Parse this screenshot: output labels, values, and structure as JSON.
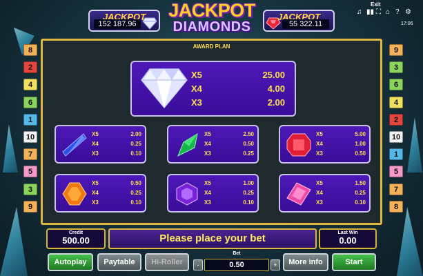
{
  "header": {
    "jackpot_left": {
      "title": "JACKPOT",
      "value": "152 187.96"
    },
    "jackpot_right": {
      "title": "JACKPOT",
      "value": "55 322.11"
    },
    "logo_line1": "JACKPOT",
    "logo_line2": "DIAMONDS",
    "exit_label": "Exit",
    "clock": "17:06"
  },
  "lines_left": [
    {
      "number": "8",
      "color": "#f3b15a"
    },
    {
      "number": "2",
      "color": "#e2463e"
    },
    {
      "number": "4",
      "color": "#f0e060"
    },
    {
      "number": "6",
      "color": "#8ad35c"
    },
    {
      "number": "1",
      "color": "#55b6e8"
    },
    {
      "number": "10",
      "color": "#f2f2f2"
    },
    {
      "number": "7",
      "color": "#f3b15a"
    },
    {
      "number": "5",
      "color": "#f49ac8"
    },
    {
      "number": "3",
      "color": "#8ad35c"
    },
    {
      "number": "9",
      "color": "#f3b15a"
    }
  ],
  "lines_right": [
    {
      "number": "9",
      "color": "#f3b15a"
    },
    {
      "number": "3",
      "color": "#8ad35c"
    },
    {
      "number": "6",
      "color": "#8ad35c"
    },
    {
      "number": "4",
      "color": "#f0e060"
    },
    {
      "number": "2",
      "color": "#e2463e"
    },
    {
      "number": "10",
      "color": "#f2f2f2"
    },
    {
      "number": "1",
      "color": "#55b6e8"
    },
    {
      "number": "5",
      "color": "#f49ac8"
    },
    {
      "number": "7",
      "color": "#f3b15a"
    },
    {
      "number": "8",
      "color": "#f3b15a"
    }
  ],
  "award_plan": {
    "title": "AWARD PLAN",
    "diamond": {
      "rows": [
        {
          "mult": "X5",
          "value": "25.00"
        },
        {
          "mult": "X4",
          "value": "4.00"
        },
        {
          "mult": "X3",
          "value": "2.00"
        }
      ]
    },
    "blue": {
      "rows": [
        {
          "mult": "X5",
          "value": "2.00"
        },
        {
          "mult": "X4",
          "value": "0.25"
        },
        {
          "mult": "X3",
          "value": "0.10"
        }
      ]
    },
    "green": {
      "rows": [
        {
          "mult": "X5",
          "value": "2.50"
        },
        {
          "mult": "X4",
          "value": "0.50"
        },
        {
          "mult": "X3",
          "value": "0.25"
        }
      ]
    },
    "red": {
      "rows": [
        {
          "mult": "X5",
          "value": "5.00"
        },
        {
          "mult": "X4",
          "value": "1.00"
        },
        {
          "mult": "X3",
          "value": "0.50"
        }
      ]
    },
    "orange": {
      "rows": [
        {
          "mult": "X5",
          "value": "0.50"
        },
        {
          "mult": "X4",
          "value": "0.25"
        },
        {
          "mult": "X3",
          "value": "0.10"
        }
      ]
    },
    "purple": {
      "rows": [
        {
          "mult": "X5",
          "value": "1.00"
        },
        {
          "mult": "X4",
          "value": "0.25"
        },
        {
          "mult": "X3",
          "value": "0.10"
        }
      ]
    },
    "pink": {
      "rows": [
        {
          "mult": "X5",
          "value": "1.50"
        },
        {
          "mult": "X4",
          "value": "0.25"
        },
        {
          "mult": "X3",
          "value": "0.10"
        }
      ]
    }
  },
  "footer": {
    "credit_label": "Credit",
    "credit_value": "500.00",
    "message": "Please place your bet",
    "last_win_label": "Last Win",
    "last_win_value": "0.00",
    "bet_label": "Bet",
    "bet_value": "0.50",
    "bet_minus": "-",
    "bet_plus": "+",
    "autoplay_label": "Autoplay",
    "paytable_label": "Paytable",
    "hi_roller_label": "Hi-Roller",
    "more_info_label": "More info",
    "start_label": "Start"
  }
}
